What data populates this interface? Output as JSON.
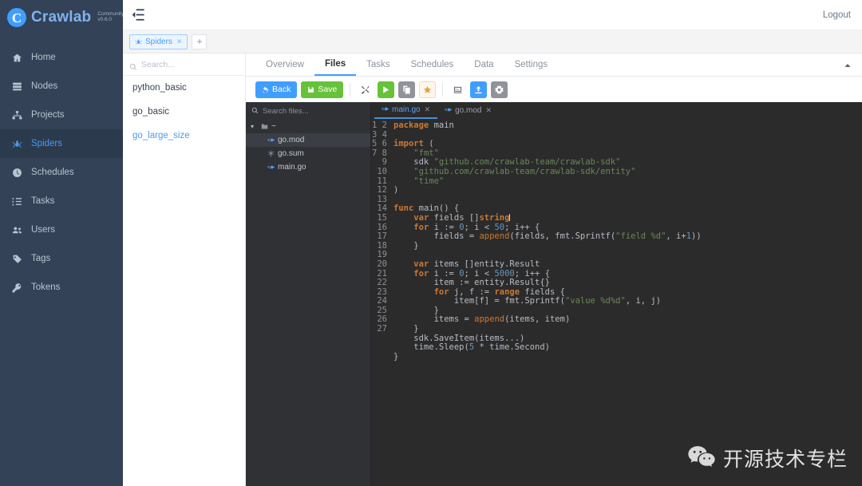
{
  "brand": {
    "name": "Crawlab",
    "edition": "Community",
    "version": "v0.6.0",
    "logo_letter": "C",
    "accent": "#409eff"
  },
  "topbar": {
    "collapse_icon": "collapse-sidebar-icon",
    "logout_label": "Logout"
  },
  "view_tabs": {
    "tabs": [
      {
        "label": "Spiders",
        "icon": "spider-icon",
        "closable": true,
        "active": true
      }
    ],
    "add_label": "+"
  },
  "spider_list": {
    "search_placeholder": "Search...",
    "search_value": "",
    "collapse_icon": "collapse-panel-icon",
    "items": [
      {
        "label": "python_basic",
        "highlighted": false
      },
      {
        "label": "go_basic",
        "highlighted": false
      },
      {
        "label": "go_large_size",
        "highlighted": true
      }
    ]
  },
  "content_tabs": [
    {
      "label": "Overview",
      "active": false
    },
    {
      "label": "Files",
      "active": true
    },
    {
      "label": "Tasks",
      "active": false
    },
    {
      "label": "Schedules",
      "active": false
    },
    {
      "label": "Data",
      "active": false
    },
    {
      "label": "Settings",
      "active": false
    }
  ],
  "panel_collapse_icon": "chevron-up-icon",
  "toolbar": {
    "back_label": "Back",
    "back_icon": "undo-icon",
    "save_label": "Save",
    "save_icon": "save-disk-icon",
    "icon_buttons": [
      {
        "name": "tools-icon",
        "style": "plain"
      },
      {
        "name": "run-play-icon",
        "style": "green"
      },
      {
        "name": "copy-files-icon",
        "style": "gray"
      },
      {
        "name": "star-icon",
        "style": "warn"
      },
      {
        "name": "terminal-icon",
        "style": "plain"
      },
      {
        "name": "upload-icon",
        "style": "blue"
      },
      {
        "name": "settings-gear-icon",
        "style": "gray"
      }
    ]
  },
  "file_tree": {
    "search_placeholder": "Search files...",
    "search_value": "",
    "gear_icon": "gear-icon",
    "minus_icon": "collapse-all-icon",
    "root_label": "~",
    "nodes": [
      {
        "label": "go.mod",
        "icon": "go-file-icon",
        "selected": true
      },
      {
        "label": "go.sum",
        "icon": "asterisk-file-icon",
        "selected": false
      },
      {
        "label": "main.go",
        "icon": "go-file-icon",
        "selected": false
      }
    ]
  },
  "editor_tabs": [
    {
      "label": "main.go",
      "icon": "go-file-icon",
      "active": true,
      "closable": true
    },
    {
      "label": "go.mod",
      "icon": "go-file-icon",
      "active": false,
      "closable": true
    }
  ],
  "code": {
    "language": "go",
    "line_count": 27,
    "lines": [
      "package main",
      "",
      "import (",
      "    \"fmt\"",
      "    sdk \"github.com/crawlab-team/crawlab-sdk\"",
      "    \"github.com/crawlab-team/crawlab-sdk/entity\"",
      "    \"time\"",
      ")",
      "",
      "func main() {",
      "    var fields []string",
      "    for i := 0; i < 50; i++ {",
      "        fields = append(fields, fmt.Sprintf(\"field %d\", i+1))",
      "    }",
      "",
      "    var items []entity.Result",
      "    for i := 0; i < 5000; i++ {",
      "        item := entity.Result{}",
      "        for j, f := range fields {",
      "            item[f] = fmt.Sprintf(\"value %d%d\", i, j)",
      "        }",
      "        items = append(items, item)",
      "    }",
      "    sdk.SaveItem(items...)",
      "    time.Sleep(5 * time.Second)",
      "}",
      ""
    ]
  },
  "sidebar": {
    "items": [
      {
        "label": "Home",
        "icon": "home-icon",
        "active": false
      },
      {
        "label": "Nodes",
        "icon": "server-icon",
        "active": false
      },
      {
        "label": "Projects",
        "icon": "sitemap-icon",
        "active": false
      },
      {
        "label": "Spiders",
        "icon": "spider-icon",
        "active": true
      },
      {
        "label": "Schedules",
        "icon": "clock-icon",
        "active": false
      },
      {
        "label": "Tasks",
        "icon": "task-list-icon",
        "active": false
      },
      {
        "label": "Users",
        "icon": "users-icon",
        "active": false
      },
      {
        "label": "Tags",
        "icon": "tag-icon",
        "active": false
      },
      {
        "label": "Tokens",
        "icon": "key-icon",
        "active": false
      }
    ]
  },
  "watermark": {
    "icon": "wechat-icon",
    "text": "开源技术专栏"
  }
}
